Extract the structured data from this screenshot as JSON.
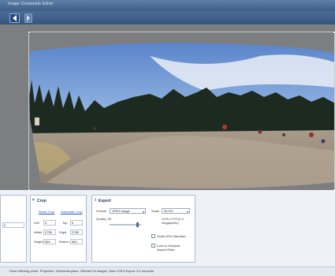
{
  "window": {
    "title": "Image Composite Editor"
  },
  "toolbar": {
    "back_icon": "back-arrow-icon",
    "forward_icon": "forward-icon"
  },
  "crop_group": {
    "title": "Crop",
    "reset_link": "Reset Crop",
    "auto_crop_link": "Automatic Crop",
    "left_label": "Left",
    "left_value": "0",
    "top_label": "Top",
    "top_value": "0",
    "width_label": "Width",
    "width_value": "2755",
    "height_label": "Height",
    "height_value": "540",
    "right_label": "Right",
    "right_value": "2755",
    "bottom_label": "Bottom",
    "bottom_value": "540"
  },
  "export_group": {
    "title": "Export",
    "format_label": "Format",
    "format_value": "JPEG Image",
    "quality_label": "Quality: 90",
    "scale_label": "Scale",
    "scale_value": "50.0%",
    "size_note": "1378 x 270 (0.4 megapixels)",
    "checkbox1_label": "Scale 40% Standard",
    "checkbox2_label": "Lock to Viewport Aspect Ratio"
  },
  "left_stub": {
    "field_value": "0"
  },
  "status": {
    "text": "Done stitching photo. Projection: Horizontal plane. Stitched 24 images. Save 100% Export. 8.1 seconds"
  },
  "colors": {
    "titlebar": "#3d5d86",
    "panel": "#eef2f7",
    "canvas": "#7d7e80"
  }
}
